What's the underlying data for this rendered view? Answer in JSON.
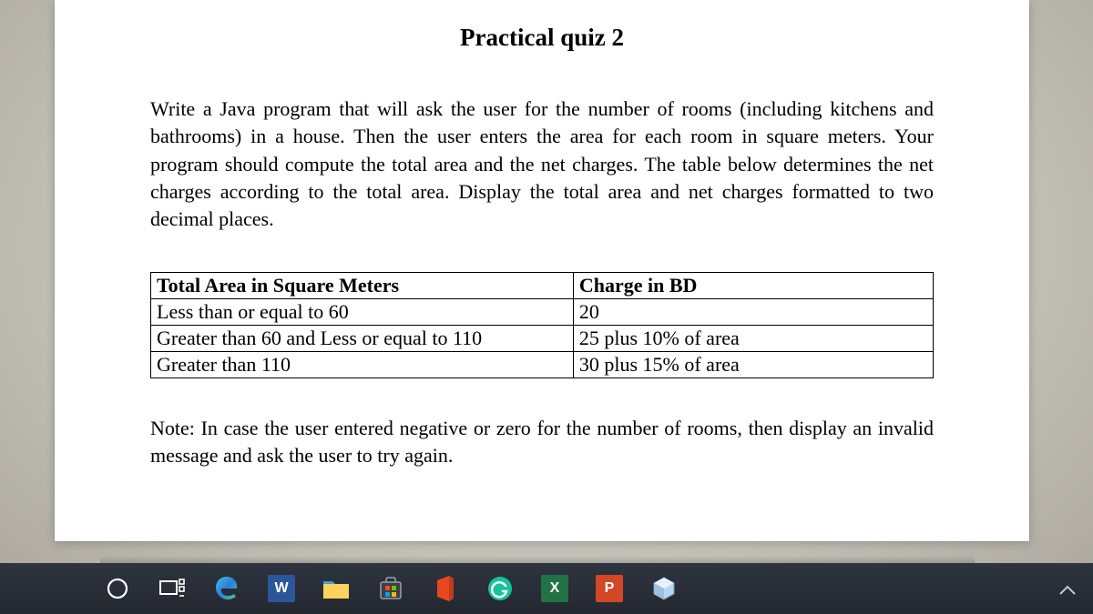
{
  "document": {
    "title": "Practical quiz 2",
    "paragraph1": "Write a Java program that will ask the user for the number of rooms (including kitchens and bathrooms) in a house. Then the user enters the area for each room in square meters. Your program should compute the total area and the net charges. The table below determines the net charges according to the total area. Display the total area and net charges formatted to two decimal places.",
    "table": {
      "header": {
        "col1": "Total Area in Square Meters",
        "col2": "Charge in BD"
      },
      "rows": [
        {
          "col1": "Less than or equal to 60",
          "col2": "20"
        },
        {
          "col1": "Greater than 60 and Less or equal to 110",
          "col2": "25 plus 10% of area"
        },
        {
          "col1": "Greater than 110",
          "col2": "30 plus 15% of area"
        }
      ]
    },
    "note": "Note: In case the user entered negative or zero for the number of rooms, then display an invalid message and ask the user to try again."
  },
  "taskbar": {
    "cortana": "O",
    "word": "W",
    "excel": "X",
    "ppt": "P"
  }
}
